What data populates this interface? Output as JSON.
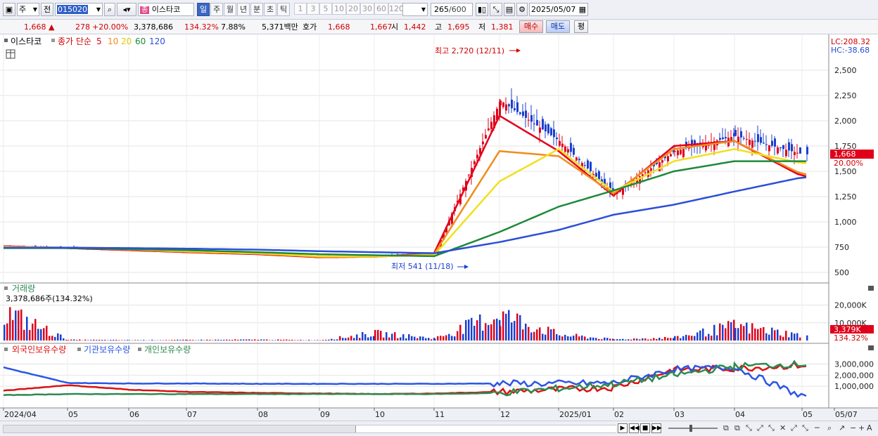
{
  "toolbar": {
    "market_select": "주",
    "prev_label": "전",
    "code": "015020",
    "stock_name_badge": "종",
    "stock_name": "이스타코",
    "periods": [
      "일",
      "주",
      "월",
      "년",
      "분",
      "초",
      "틱"
    ],
    "active_period": "일",
    "intervals": [
      "1",
      "3",
      "5",
      "10",
      "20",
      "30",
      "60",
      "120"
    ],
    "count": "265",
    "count_total": "/600",
    "date": "2025/05/07"
  },
  "quote": {
    "price": "1,668",
    "change_arrow": "▲",
    "change": "278",
    "change_pct": "+20.00%",
    "volume": "3,378,686",
    "volume_ratio": "134.32%",
    "turnover": "7.88%",
    "amount": "5,371백만",
    "hoga_label": "호가",
    "ask": "1,668",
    "bid": "1,667",
    "open_label": "시",
    "open": "1,442",
    "high_label": "고",
    "high": "1,695",
    "low_label": "저",
    "low": "1,381",
    "buy_label": "매수",
    "sell_label": "매도",
    "eval_label": "평"
  },
  "price_panel": {
    "name": "이스타코",
    "ma_type": "종가 단순",
    "ma_periods": [
      "5",
      "10",
      "20",
      "60",
      "120"
    ],
    "lc": "LC:208.32",
    "hc": "HC:-38.68",
    "current_tag": "1,668",
    "pct_tag": "20.00%",
    "max_label": "최고 2,720 (12/11)",
    "min_label": "최저 541 (11/18)"
  },
  "volume_panel": {
    "title": "거래량",
    "value": "3,378,686주(134.32%)",
    "tag": "3,379K",
    "tag_pct": "134.32%"
  },
  "holding_panel": {
    "series": [
      "외국인보유수량",
      "기관보유수량",
      "개인보유수량"
    ]
  },
  "x_axis": [
    "2024/04",
    "05",
    "06",
    "07",
    "08",
    "09",
    "10",
    "11",
    "12",
    "2025/01",
    "02",
    "03",
    "04",
    "05",
    "05/07"
  ],
  "colors": {
    "up": "#e0001b",
    "down": "#1a3fd0",
    "ma5": "#e3001b",
    "ma10": "#f08c1e",
    "ma20": "#f0e020",
    "ma60": "#1e8a3a",
    "ma120": "#2b4fd8",
    "foreign": "#dd1111",
    "institution": "#2b55e6",
    "individual": "#2e8a50"
  },
  "chart_data": [
    {
      "type": "candlestick",
      "title": "이스타코",
      "ylim": [
        400,
        2720
      ],
      "y_ticks": [
        "2,500",
        "2,250",
        "2,000",
        "1,750",
        "1,500",
        "1,250",
        "1,000",
        "750",
        "500"
      ],
      "x": [
        "2024/04",
        "05",
        "06",
        "07",
        "08",
        "09",
        "10",
        "11",
        "12",
        "2025/01",
        "02",
        "03",
        "04",
        "05"
      ],
      "close": [
        760,
        745,
        725,
        705,
        690,
        655,
        660,
        690,
        2200,
        1800,
        1270,
        1700,
        1850,
        1668
      ],
      "annotations": [
        {
          "label": "최고",
          "value": 2720,
          "date": "12/11"
        },
        {
          "label": "최저",
          "value": 541,
          "date": "11/18"
        }
      ],
      "series": [
        {
          "name": "5",
          "values": [
            760,
            740,
            720,
            700,
            680,
            650,
            655,
            690,
            2050,
            1700,
            1260,
            1750,
            1800,
            1450
          ]
        },
        {
          "name": "10",
          "values": [
            755,
            745,
            725,
            705,
            685,
            655,
            655,
            680,
            1700,
            1650,
            1280,
            1720,
            1800,
            1470
          ]
        },
        {
          "name": "20",
          "values": [
            750,
            745,
            730,
            710,
            690,
            660,
            660,
            670,
            1400,
            1720,
            1300,
            1600,
            1720,
            1580
          ]
        },
        {
          "name": "60",
          "values": [
            740,
            740,
            730,
            720,
            700,
            680,
            670,
            660,
            900,
            1150,
            1310,
            1500,
            1600,
            1600
          ]
        },
        {
          "name": "120",
          "values": [
            745,
            745,
            740,
            735,
            725,
            710,
            700,
            690,
            800,
            920,
            1070,
            1170,
            1300,
            1440
          ]
        }
      ]
    },
    {
      "type": "bar",
      "title": "거래량",
      "y_ticks": [
        "20,000K",
        "10,000K"
      ],
      "x": [
        "2024/04",
        "05",
        "06",
        "07",
        "08",
        "09",
        "10",
        "11",
        "12",
        "2025/01",
        "02",
        "03",
        "04",
        "05"
      ],
      "values": [
        20000,
        500,
        300,
        400,
        600,
        300,
        5000,
        1500,
        18000,
        4000,
        800,
        2000,
        10000,
        3379
      ]
    },
    {
      "type": "line",
      "y_ticks": [
        "3,000,000",
        "2,000,000",
        "1,000,000"
      ],
      "x": [
        "2024/04",
        "05",
        "06",
        "07",
        "08",
        "09",
        "10",
        "11",
        "12",
        "2025/01",
        "02",
        "03",
        "04",
        "05"
      ],
      "series": [
        {
          "name": "외국인보유수량",
          "values": [
            600000,
            1100000,
            700000,
            500000,
            400000,
            350000,
            300000,
            350000,
            500000,
            700000,
            900000,
            2500000,
            2600000,
            2900000
          ]
        },
        {
          "name": "기관보유수량",
          "values": [
            2700000,
            1300000,
            1250000,
            1250000,
            1220000,
            1220000,
            1220000,
            1220000,
            1250000,
            1250000,
            1300000,
            2500000,
            2700000,
            100000
          ]
        },
        {
          "name": "개인보유수량",
          "values": [
            200000,
            300000,
            300000,
            300000,
            300000,
            300000,
            300000,
            300000,
            400000,
            800000,
            1200000,
            2000000,
            2800000,
            3000000
          ]
        }
      ]
    }
  ]
}
